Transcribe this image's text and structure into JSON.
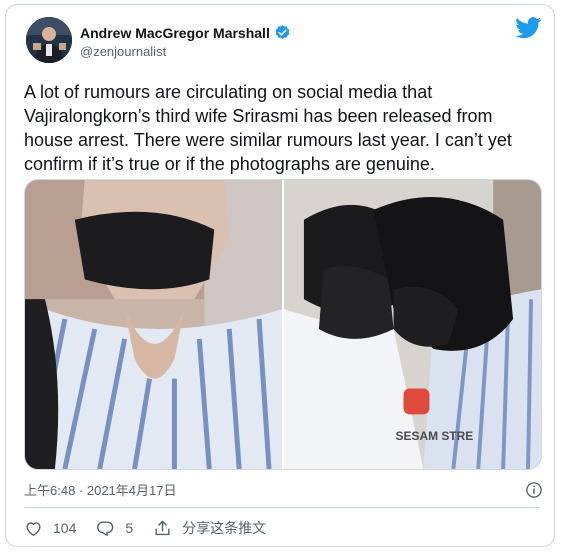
{
  "author": {
    "display_name": "Andrew MacGregor Marshall",
    "handle": "@zenjournalist",
    "verified": true
  },
  "tweet": {
    "lines": [
      "A lot of rumours are circulating on social media that",
      "Vajiralongkorn’s third wife Srirasmi has been released from",
      "house arrest. There were similar rumours last year. I can’t yet",
      "confirm if it’s true or if the photographs are genuine."
    ]
  },
  "media": {
    "photo_right_caption": "SESAM STRE"
  },
  "meta": {
    "timestamp": "上午6:48 · 2021年4月17日"
  },
  "actions": {
    "likes": "104",
    "replies": "5",
    "share_label": "分享这条推文"
  },
  "icons": {
    "brand": "twitter-bird-icon",
    "verified": "verified-badge-icon",
    "info": "info-icon",
    "like": "heart-icon",
    "reply": "reply-bubble-icon",
    "share": "share-icon"
  },
  "colors": {
    "twitter_blue": "#1d9bf0",
    "secondary_text": "#536471",
    "border": "#cfd9de"
  }
}
